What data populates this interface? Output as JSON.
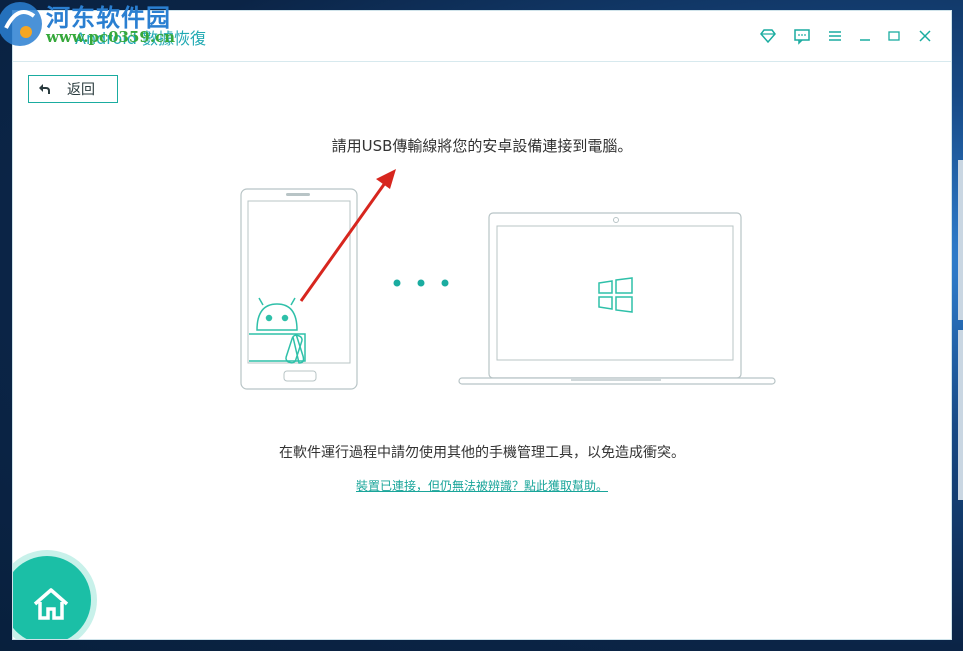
{
  "watermark": {
    "site_name": "河东软件园",
    "url": "www.pc0359.cn"
  },
  "app": {
    "title": "Android 數據恢復"
  },
  "titlebar_icons": [
    "diamond-icon",
    "feedback-icon",
    "menu-icon",
    "minimize-icon",
    "maximize-icon",
    "close-icon"
  ],
  "back_button": {
    "label": "返回"
  },
  "main": {
    "instruction": "請用USB傳輸線將您的安卓設備連接到電腦。",
    "warning": "在軟件運行過程中請勿使用其他的手機管理工具，以免造成衝突。",
    "help_link": "裝置已連接，但仍無法被辨識？點此獲取幫助。"
  },
  "colors": {
    "accent": "#1aaca0",
    "arrow": "#d7261e",
    "home": "#1bbfa6"
  }
}
